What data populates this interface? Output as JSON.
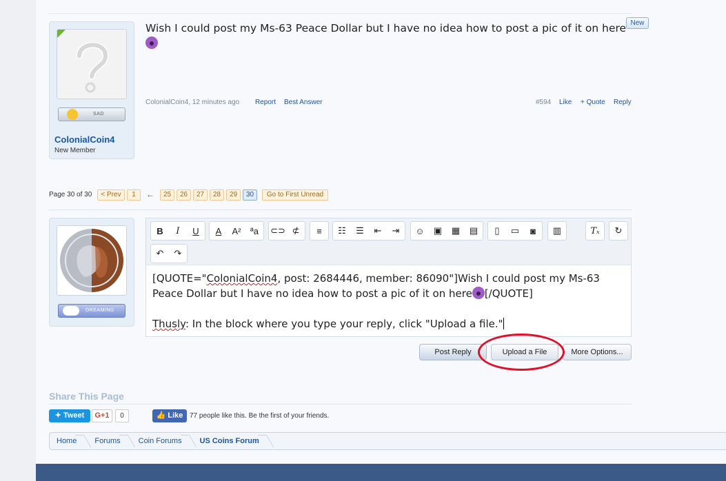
{
  "post": {
    "user": {
      "name": "ColonialCoin4",
      "title": "New Member",
      "mood": "SAD"
    },
    "text": "Wish I could post my Ms-63 Peace Dollar but I have no idea how to post a pic of it on here",
    "new_label": "New",
    "author_time": "ColonialCoin4, 12 minutes ago",
    "report": "Report",
    "best_answer": "Best Answer",
    "number": "#594",
    "like": "Like",
    "quote": "+ Quote",
    "reply": "Reply"
  },
  "pagination": {
    "label": "Page 30 of 30",
    "prev": "< Prev",
    "first": "1",
    "arrow": "←",
    "pages": [
      "25",
      "26",
      "27",
      "28",
      "29",
      "30"
    ],
    "go_first_unread": "Go to First Unread"
  },
  "reply_editor": {
    "mood": "DREAMING",
    "quote_open": "[QUOTE=\"",
    "quote_user": "ColonialCoin4",
    "quote_rest": ", post: 2684446, member: 86090\"]Wish I could post my Ms-63 Peace Dollar but I have no idea how to post a pic of it on here",
    "quote_close": "[/QUOTE]",
    "line2_word": "Thusly",
    "line2_rest": ": In the block where you type your reply, click \"Upload a file.\""
  },
  "buttons": {
    "post_reply": "Post Reply",
    "upload_file": "Upload a File",
    "more_options": "More Options..."
  },
  "share": {
    "title": "Share This Page",
    "tweet": "Tweet",
    "gplus": "G+1",
    "gplus_count": "0",
    "fb_like": "Like",
    "fb_text": "77 people like this. Be the first of your friends."
  },
  "breadcrumb": [
    "Home",
    "Forums",
    "Coin Forums",
    "US Coins Forum"
  ],
  "colors": {
    "accent": "#1a56a3",
    "highlight_circle": "#e0102a",
    "footer": "#3b5a88"
  }
}
